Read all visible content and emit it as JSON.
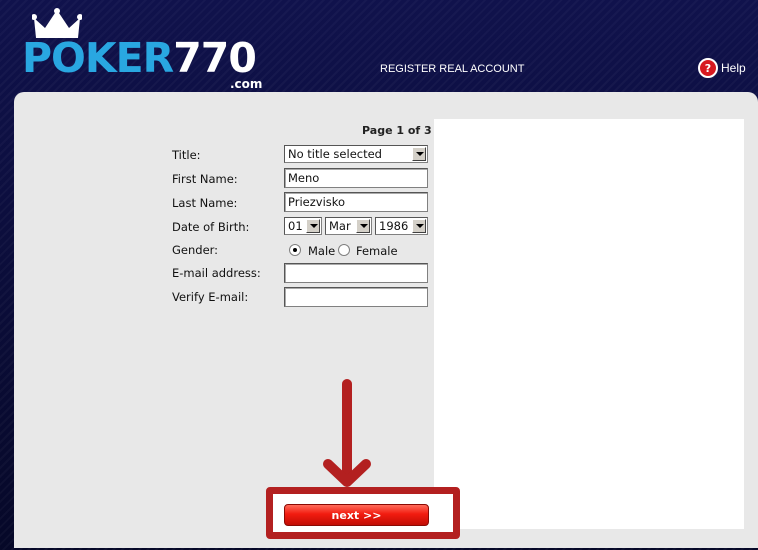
{
  "header": {
    "logo_word_poker": "POKER",
    "logo_word_number": "770",
    "logo_dotcom": ".com",
    "register_link": "REGISTER REAL ACCOUNT",
    "help_label": "Help",
    "help_icon_glyph": "?"
  },
  "form": {
    "page_indicator": "Page 1 of 3",
    "title_label": "Title:",
    "title_value": "No title selected",
    "first_name_label": "First Name:",
    "first_name_value": "Meno",
    "last_name_label": "Last Name:",
    "last_name_value": "Priezvisko",
    "dob_label": "Date of Birth:",
    "dob_day": "01",
    "dob_month": "Mar",
    "dob_year": "1986",
    "gender_label": "Gender:",
    "gender_male": "Male",
    "gender_female": "Female",
    "gender_selected": "Male",
    "email_label": "E-mail address:",
    "email_value": "",
    "verify_email_label": "Verify E-mail:",
    "verify_email_value": ""
  },
  "actions": {
    "next_label": "next >>"
  },
  "colors": {
    "brand_blue": "#29a7e1",
    "header_bg": "#0d0f3f",
    "annotation_red": "#b32020",
    "button_red": "#f21c10"
  }
}
